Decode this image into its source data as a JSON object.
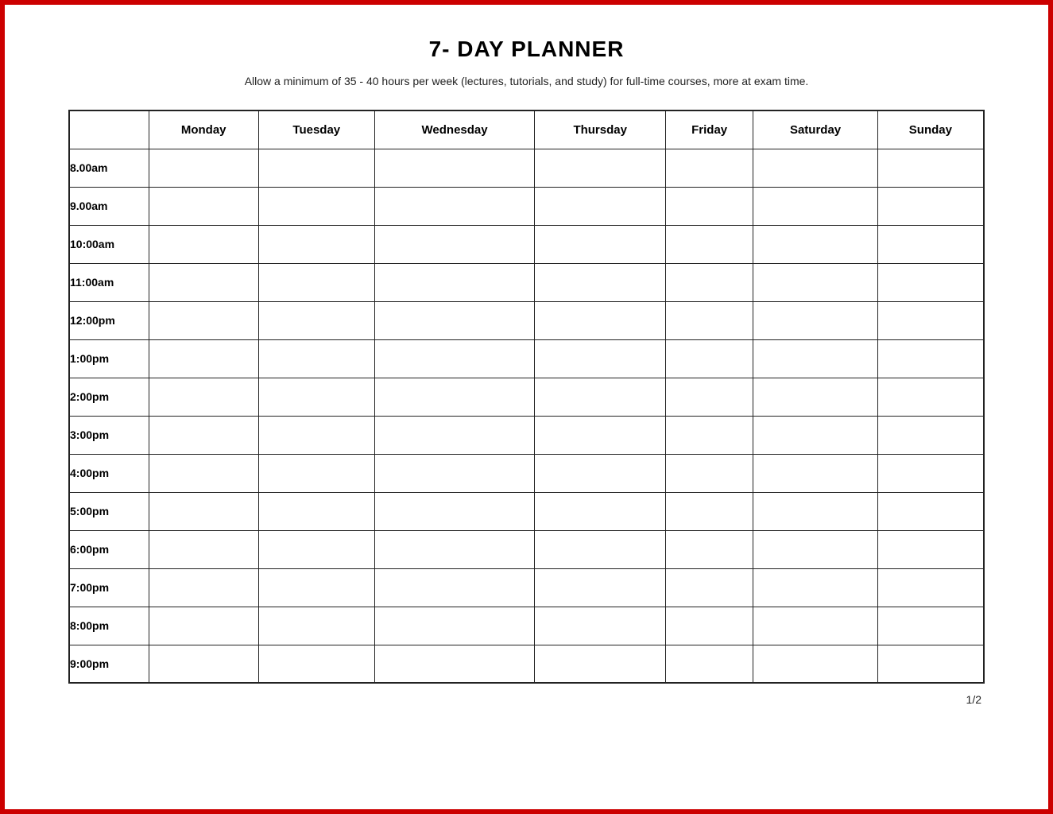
{
  "page": {
    "title": "7- DAY PLANNER",
    "subtitle": "Allow a minimum of 35 - 40 hours per week (lectures, tutorials, and study) for full-time courses, more at exam time.",
    "page_number": "1/2"
  },
  "table": {
    "headers": [
      "",
      "Monday",
      "Tuesday",
      "Wednesday",
      "Thursday",
      "Friday",
      "Saturday",
      "Sunday"
    ],
    "time_slots": [
      "8.00am",
      "9.00am",
      "10:00am",
      "11:00am",
      "12:00pm",
      "1:00pm",
      "2:00pm",
      "3:00pm",
      "4:00pm",
      "5:00pm",
      "6:00pm",
      "7:00pm",
      "8:00pm",
      "9:00pm"
    ]
  }
}
